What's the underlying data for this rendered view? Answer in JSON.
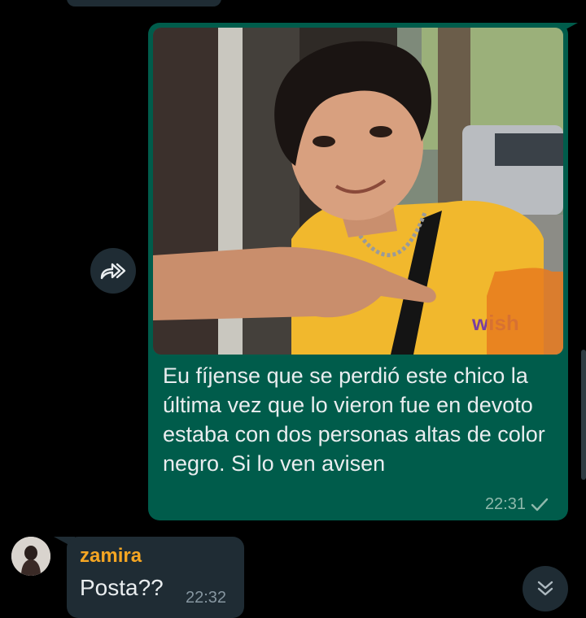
{
  "outgoing_message": {
    "caption": "Eu fíjense que se perdió este chico la última vez que lo vieron fue en devoto estaba con dos personas altas de color negro. Si lo ven avisen",
    "time": "22:31",
    "status_icon": "single-check-icon",
    "photo": {
      "icon": "photo-of-young-man",
      "shirt_text": "wish"
    }
  },
  "forward_button": {
    "icon": "forward-icon"
  },
  "incoming_message": {
    "sender": "zamira",
    "text": "Posta??",
    "time": "22:32",
    "avatar_icon": "avatar-image"
  },
  "scroll_down_button": {
    "icon": "double-chevron-down-icon"
  },
  "colors": {
    "background": "#000000",
    "outgoing_bubble": "#005c4b",
    "incoming_bubble": "#1f2c34",
    "sender_name": "#f5a623"
  }
}
